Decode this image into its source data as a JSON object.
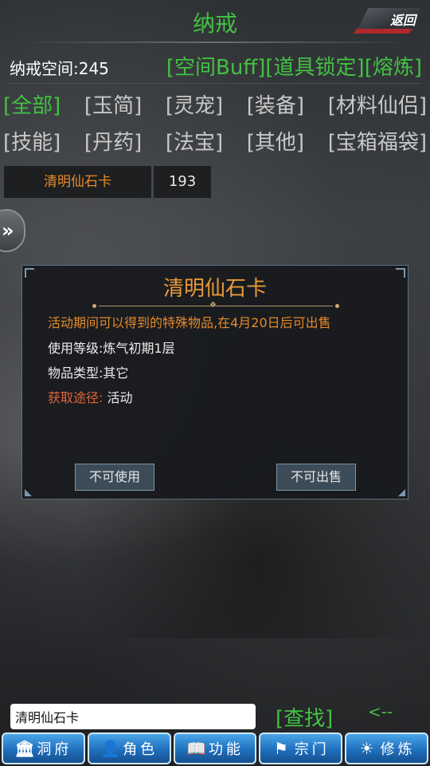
{
  "header": {
    "title": "纳戒",
    "back_label": "返回"
  },
  "space": {
    "label": "纳戒空间:245"
  },
  "top_actions": [
    "[空间Buff]",
    "[道具锁定]",
    "[熔炼]"
  ],
  "categories": [
    [
      "[全部]",
      "[玉简]",
      "[灵宠]",
      "[装备]",
      "[材料仙侣]"
    ],
    [
      "[技能]",
      "[丹药]",
      "[法宝]",
      "[其他]",
      "[宝箱福袋]"
    ]
  ],
  "active_category": "[全部]",
  "item": {
    "name": "清明仙石卡",
    "count": "193"
  },
  "side_toggle": {
    "glyph": "»"
  },
  "modal": {
    "title": "清明仙石卡",
    "description": "活动期间可以得到的特殊物品,在4月20日后可出售",
    "level": "使用等级:炼气初期1层",
    "type": "物品类型:其它",
    "source_label": "获取途径:",
    "source_value": " 活动",
    "use_button": "不可使用",
    "sell_button": "不可出售"
  },
  "search": {
    "value": "清明仙石卡",
    "find_label": "[查找]",
    "back_label": "<--"
  },
  "bottom_nav": [
    {
      "icon": "temple-icon",
      "glyph": "🏛",
      "label": "洞府"
    },
    {
      "icon": "character-icon",
      "glyph": "👤",
      "label": "角色"
    },
    {
      "icon": "book-icon",
      "glyph": "📖",
      "label": "功能"
    },
    {
      "icon": "flag-icon",
      "glyph": "⚑",
      "label": "宗门"
    },
    {
      "icon": "sun-icon",
      "glyph": "☀",
      "label": "修炼"
    }
  ],
  "colors": {
    "accent_green": "#43c143",
    "item_orange": "#e58a2a",
    "nav_blue": "#1f6fbd"
  }
}
